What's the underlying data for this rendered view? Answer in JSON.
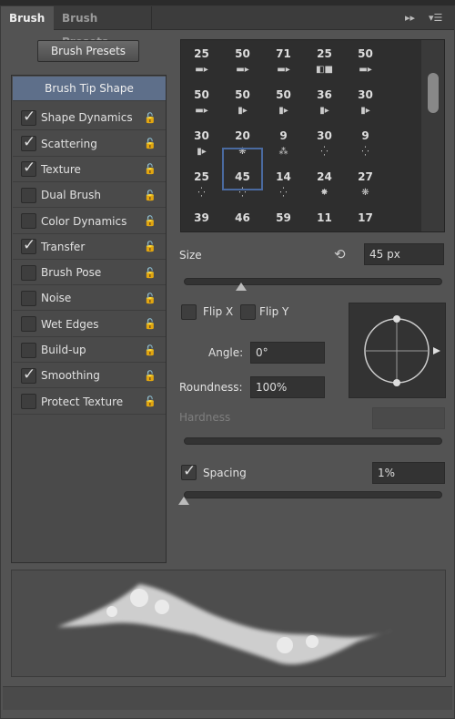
{
  "tabs": [
    {
      "label": "Brush",
      "active": true
    },
    {
      "label": "Brush Presets",
      "active": false
    }
  ],
  "tab_icons": [
    "fast-forward-icon",
    "panel-menu-icon"
  ],
  "brush_presets_button": "Brush Presets",
  "left_list": [
    {
      "label": "Brush Tip Shape",
      "selected": true
    },
    {
      "label": "Shape Dynamics",
      "checked": true
    },
    {
      "label": "Scattering",
      "checked": true
    },
    {
      "label": "Texture",
      "checked": true
    },
    {
      "label": "Dual Brush",
      "checked": false
    },
    {
      "label": "Color Dynamics",
      "checked": false
    },
    {
      "label": "Transfer",
      "checked": true
    },
    {
      "label": "Brush Pose",
      "checked": false
    },
    {
      "label": "Noise",
      "checked": false
    },
    {
      "label": "Wet Edges",
      "checked": false
    },
    {
      "label": "Build-up",
      "checked": false
    },
    {
      "label": "Smoothing",
      "checked": true
    },
    {
      "label": "Protect Texture",
      "checked": false
    }
  ],
  "brush_grid": [
    [
      "25",
      "50",
      "71",
      "25",
      "50"
    ],
    [
      "50",
      "50",
      "50",
      "36",
      "30"
    ],
    [
      "30",
      "20",
      "9",
      "30",
      "9"
    ],
    [
      "25",
      "45",
      "14",
      "24",
      "27"
    ],
    [
      "39",
      "46",
      "59",
      "11",
      "17"
    ]
  ],
  "selected_brush": "45",
  "size": {
    "label": "Size",
    "value": "45 px",
    "slider": 0.2
  },
  "flip_x": {
    "label": "Flip X",
    "checked": false
  },
  "flip_y": {
    "label": "Flip Y",
    "checked": false
  },
  "angle": {
    "label": "Angle:",
    "value": "0°"
  },
  "roundness": {
    "label": "Roundness:",
    "value": "100%"
  },
  "hardness": {
    "label": "Hardness",
    "value": ""
  },
  "spacing": {
    "label": "Spacing",
    "checked": true,
    "value": "1%",
    "slider": 0.0
  },
  "accent": "#5e6f8a"
}
